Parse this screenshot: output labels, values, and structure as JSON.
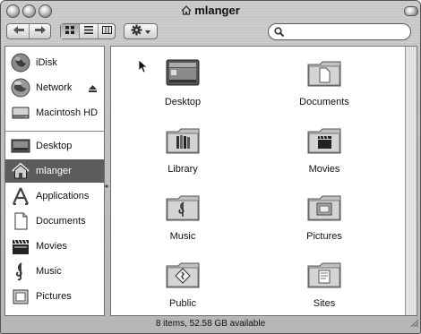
{
  "window": {
    "title": "mlanger",
    "title_icon": "home-icon"
  },
  "toolbar": {
    "back_icon": "back-arrow-icon",
    "forward_icon": "forward-arrow-icon",
    "view_modes": [
      "icon-view-icon",
      "list-view-icon",
      "column-view-icon"
    ],
    "selected_view": "icon-view-icon",
    "action_icon": "gear-icon",
    "search": {
      "value": "",
      "placeholder": ""
    }
  },
  "sidebar": {
    "devices": [
      {
        "label": "iDisk",
        "icon": "globe-icon"
      },
      {
        "label": "Network",
        "icon": "network-globe-icon",
        "ejectable": true
      },
      {
        "label": "Macintosh HD",
        "icon": "hard-disk-icon"
      }
    ],
    "places": [
      {
        "label": "Desktop",
        "icon": "desktop-icon"
      },
      {
        "label": "mlanger",
        "icon": "home-icon",
        "selected": true
      },
      {
        "label": "Applications",
        "icon": "applications-icon"
      },
      {
        "label": "Documents",
        "icon": "document-icon"
      },
      {
        "label": "Movies",
        "icon": "clapper-icon"
      },
      {
        "label": "Music",
        "icon": "music-clef-icon"
      },
      {
        "label": "Pictures",
        "icon": "picture-frame-icon"
      }
    ]
  },
  "items": [
    {
      "label": "Desktop",
      "icon": "desktop-folder-icon"
    },
    {
      "label": "Documents",
      "icon": "documents-folder-icon"
    },
    {
      "label": "Library",
      "icon": "library-folder-icon"
    },
    {
      "label": "Movies",
      "icon": "movies-folder-icon"
    },
    {
      "label": "Music",
      "icon": "music-folder-icon"
    },
    {
      "label": "Pictures",
      "icon": "pictures-folder-icon"
    },
    {
      "label": "Public",
      "icon": "public-folder-icon"
    },
    {
      "label": "Sites",
      "icon": "sites-folder-icon"
    }
  ],
  "status_bar": {
    "text": "8 items, 52.58 GB available"
  },
  "colors": {
    "selection": "#5c5c5c",
    "chrome": "#c6c6c6"
  }
}
